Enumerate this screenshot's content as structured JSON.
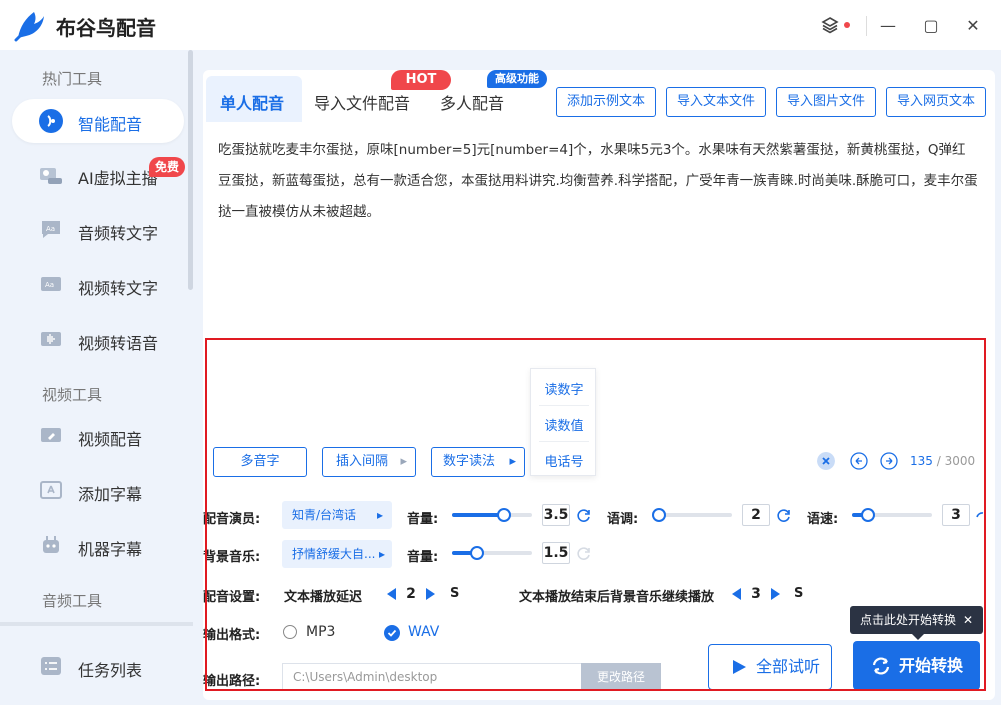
{
  "app": {
    "title": "布谷鸟配音"
  },
  "window": {
    "close_glyph": "✕",
    "min_glyph": "—",
    "max_glyph": "▢"
  },
  "sidebar": {
    "sections": [
      "热门工具",
      "视频工具",
      "音频工具"
    ],
    "items": [
      {
        "label": "智能配音",
        "icon": "voice-icon",
        "active": true
      },
      {
        "label": "AI虚拟主播",
        "icon": "ai-anchor-icon",
        "badge": "免费"
      },
      {
        "label": "音频转文字",
        "icon": "audio-text-icon"
      },
      {
        "label": "视频转文字",
        "icon": "video-text-icon"
      },
      {
        "label": "视频转语音",
        "icon": "video-voice-icon"
      },
      {
        "label": "视频配音",
        "icon": "video-dub-icon"
      },
      {
        "label": "添加字幕",
        "icon": "subtitle-icon"
      },
      {
        "label": "机器字幕",
        "icon": "robot-subtitle-icon"
      },
      {
        "label": "任务列表",
        "icon": "task-list-icon"
      }
    ]
  },
  "tabs": [
    {
      "label": "单人配音",
      "active": true
    },
    {
      "label": "导入文件配音",
      "badge": "HOT"
    },
    {
      "label": "多人配音",
      "badge": "高级功能"
    }
  ],
  "top_buttons": [
    "添加示例文本",
    "导入文本文件",
    "导入图片文件",
    "导入网页文本"
  ],
  "editor": {
    "text": "吃蛋挞就吃麦丰尔蛋挞，原味[number=5]元[number=4]个，水果味5元3个。水果味有天然紫薯蛋挞，新黄桃蛋挞，Q弹红豆蛋挞，新蓝莓蛋挞，总有一款适合您，本蛋挞用料讲究.均衡营养.科学搭配，广受年青一族青睐.时尚美味.酥脆可口，麦丰尔蛋挞一直被模仿从未被超越。",
    "count": "135",
    "max": "3000"
  },
  "number_popup": [
    "读数字",
    "读数值",
    "电话号"
  ],
  "tools": [
    {
      "label": "多音字"
    },
    {
      "label": "插入间隔",
      "arrow": "▸"
    },
    {
      "label": "数字读法",
      "arrow": "▸"
    }
  ],
  "settings": {
    "voice_label": "配音演员:",
    "voice_value": "知青/台湾话",
    "volume_label": "音量:",
    "volume_value": "3.5",
    "tone_label": "语调:",
    "tone_value": "2",
    "speed_label": "语速:",
    "speed_value": "3",
    "bgm_label": "背景音乐:",
    "bgm_value": "抒情舒缓大自...",
    "bgm_volume_label": "音量:",
    "bgm_volume_value": "1.5",
    "dub_label": "配音设置:",
    "delay_label": "文本播放延迟",
    "delay_value": "2",
    "delay_unit": "S",
    "bgm_continue_label": "文本播放结束后背景音乐继续播放",
    "bgm_continue_value": "3",
    "bgm_continue_unit": "S",
    "format_label": "输出格式:",
    "format_options": [
      "MP3",
      "WAV"
    ],
    "format_selected": "WAV",
    "path_label": "输出路径:",
    "path_value": "C:\\Users\\Admin\\desktop",
    "path_button": "更改路径"
  },
  "actions": {
    "preview": "全部试听",
    "start": "开始转换",
    "tooltip": "点击此处开始转换",
    "tooltip_close": "✕"
  },
  "colors": {
    "accent": "#1a6ee6",
    "hot": "#f0474b",
    "frame": "#e01a22"
  }
}
